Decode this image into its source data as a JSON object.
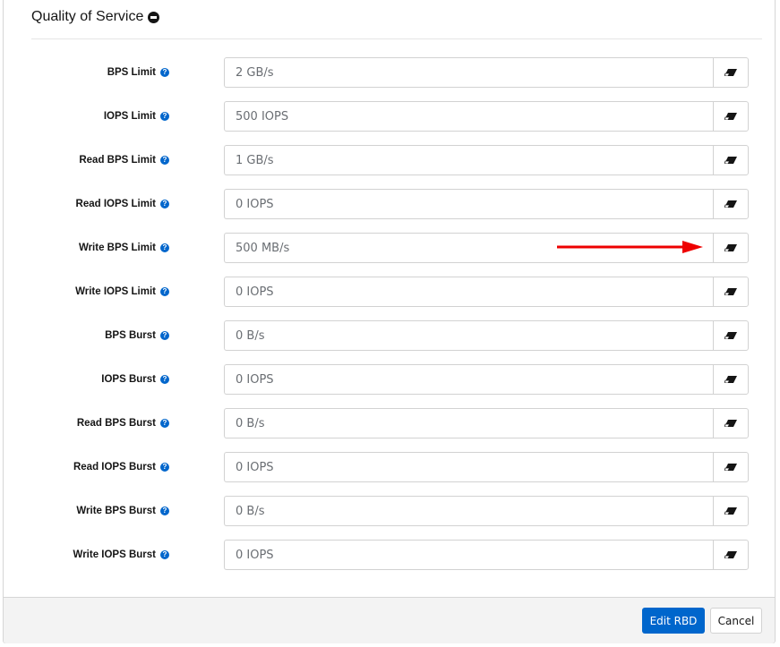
{
  "section": {
    "title": "Quality of Service",
    "collapse_icon": "minus-circle-icon"
  },
  "fields": [
    {
      "label": "BPS Limit",
      "value": "2 GB/s"
    },
    {
      "label": "IOPS Limit",
      "value": "500 IOPS"
    },
    {
      "label": "Read BPS Limit",
      "value": "1 GB/s"
    },
    {
      "label": "Read IOPS Limit",
      "value": "0 IOPS"
    },
    {
      "label": "Write BPS Limit",
      "value": "500 MB/s"
    },
    {
      "label": "Write IOPS Limit",
      "value": "0 IOPS"
    },
    {
      "label": "BPS Burst",
      "value": "0 B/s"
    },
    {
      "label": "IOPS Burst",
      "value": "0 IOPS"
    },
    {
      "label": "Read BPS Burst",
      "value": "0 B/s"
    },
    {
      "label": "Read IOPS Burst",
      "value": "0 IOPS"
    },
    {
      "label": "Write BPS Burst",
      "value": "0 B/s"
    },
    {
      "label": "Write IOPS Burst",
      "value": "0 IOPS"
    }
  ],
  "help_icon_glyph": "?",
  "annotation": {
    "type": "red-arrow",
    "points_to": "Write BPS Limit clear button",
    "color": "#ee0000"
  },
  "footer": {
    "submit_label": "Edit RBD",
    "cancel_label": "Cancel"
  },
  "colors": {
    "primary": "#0066cc",
    "help": "#0066cc"
  }
}
